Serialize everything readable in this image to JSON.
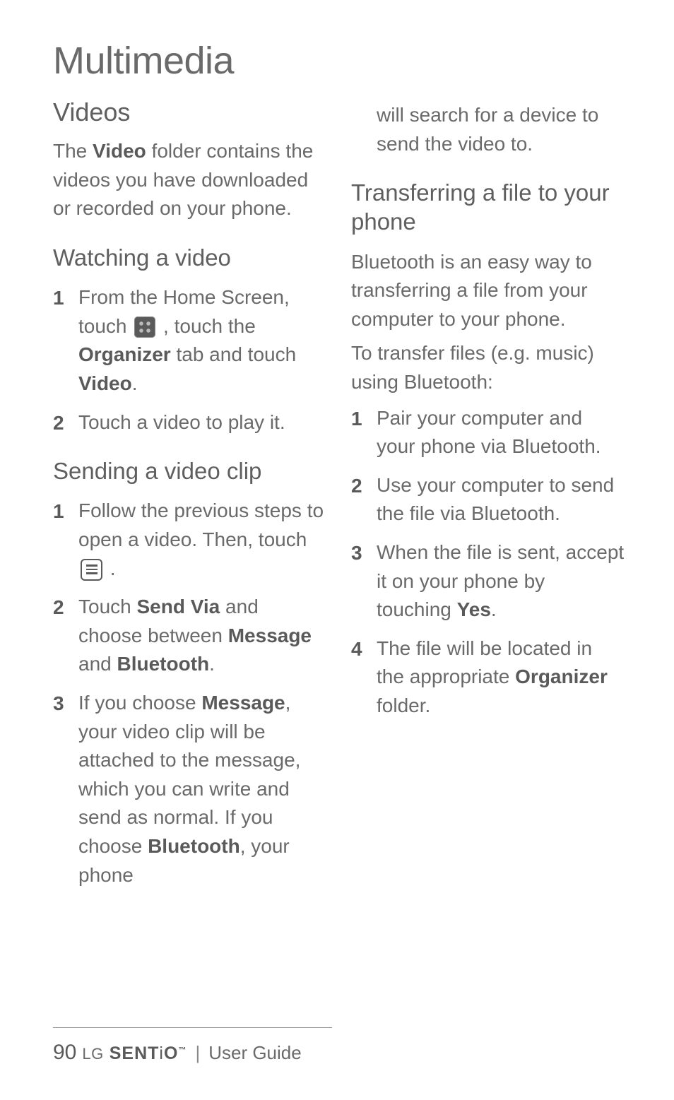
{
  "page_title": "Multimedia",
  "left": {
    "heading_videos": "Videos",
    "intro_pre": "The ",
    "intro_bold1": "Video",
    "intro_post": " folder contains the videos you have downloaded or recorded on your phone.",
    "heading_watching": "Watching a video",
    "watch_step1_a": "From the Home Screen, touch ",
    "watch_step1_b": " , touch the ",
    "watch_step1_bold": "Organizer",
    "watch_step1_c": " tab and touch ",
    "watch_step1_bold2": "Video",
    "watch_step1_d": ".",
    "watch_step2": "Touch a video to play it.",
    "heading_sending": "Sending a video clip",
    "send_step1_a": "Follow the previous steps to open a video. Then, touch ",
    "send_step1_b": " .",
    "send_step2_a": "Touch ",
    "send_step2_bold1": "Send Via",
    "send_step2_b": " and choose between ",
    "send_step2_bold2": "Message",
    "send_step2_c": " and ",
    "send_step2_bold3": "Bluetooth",
    "send_step2_d": ".",
    "send_step3_a": "If you choose ",
    "send_step3_bold1": "Message",
    "send_step3_b": ", your video clip will be attached to the message, which you can write and send as normal. If you choose ",
    "send_step3_bold2": "Bluetooth",
    "send_step3_c": ", your phone"
  },
  "right": {
    "cont_text": "will search for a device to send the video to.",
    "heading_transfer": "Transferring a file to your phone",
    "transfer_intro": "Bluetooth is an easy way to transferring a file from your computer to your phone.",
    "transfer_sub": "To transfer files (e.g. music) using Bluetooth:",
    "transfer_step1": "Pair your computer and your phone via Bluetooth.",
    "transfer_step2": "Use your computer to send the file via Bluetooth.",
    "transfer_step3_a": "When the file is sent, accept it on your phone by touching ",
    "transfer_step3_bold": "Yes",
    "transfer_step3_b": ".",
    "transfer_step4_a": "The file will be located in the appropriate ",
    "transfer_step4_bold": "Organizer",
    "transfer_step4_b": " folder."
  },
  "footer": {
    "page_number": "90",
    "brand_lg": "LG",
    "brand_sentio_a": "SENT",
    "brand_sentio_b": "i",
    "brand_sentio_c": "O",
    "brand_tm": "™",
    "separator": "|",
    "guide_label": "User Guide"
  }
}
